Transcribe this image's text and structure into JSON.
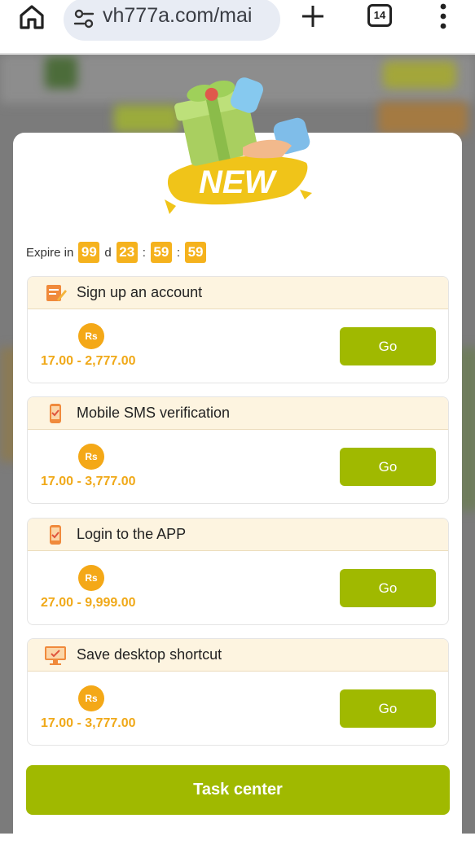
{
  "browser": {
    "url": "vh777a.com/mai",
    "tab_count": "14"
  },
  "promo": {
    "badge_text": "NEW"
  },
  "expire": {
    "label": "Expire in",
    "days": "99",
    "days_unit": "d",
    "hours": "23",
    "minutes": "59",
    "seconds": "59",
    "sep": ":"
  },
  "tasks": [
    {
      "title": "Sign up an account",
      "currency": "Rs",
      "range": "17.00 - 2,777.00",
      "button": "Go",
      "icon": "form-icon"
    },
    {
      "title": "Mobile SMS verification",
      "currency": "Rs",
      "range": "17.00 - 3,777.00",
      "button": "Go",
      "icon": "phone-check-icon"
    },
    {
      "title": "Login to the APP",
      "currency": "Rs",
      "range": "27.00 - 9,999.00",
      "button": "Go",
      "icon": "phone-app-icon"
    },
    {
      "title": "Save desktop shortcut",
      "currency": "Rs",
      "range": "17.00 - 3,777.00",
      "button": "Go",
      "icon": "desktop-icon"
    }
  ],
  "task_center_label": "Task center",
  "colors": {
    "accent": "#a0b900",
    "gold": "#f4a817",
    "header_bg": "#fdf4e0"
  }
}
